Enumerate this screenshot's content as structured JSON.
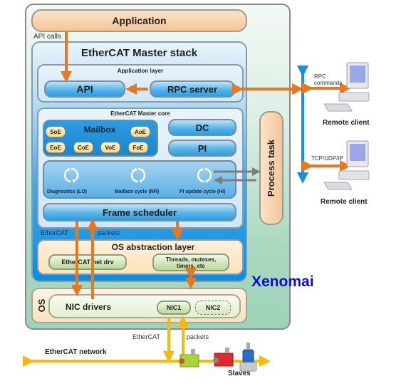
{
  "application": "Application",
  "api_calls": "API calls",
  "master_stack": {
    "title": "EtherCAT Master stack",
    "application_layer": {
      "title": "Application layer",
      "api": "API",
      "rpc_server": "RPC server"
    },
    "core": {
      "title": "EtherCAT Master core",
      "mailbox": {
        "title": "Mailbox",
        "protocols": [
          "SoE",
          "AoE",
          "EoE",
          "CoE",
          "VoE",
          "FoE"
        ]
      },
      "dc": "DC",
      "pi": "PI",
      "cycles": [
        "Diagnostics (LO)",
        "Mailbox cycle (NR)",
        "PI update cycle (HI)"
      ],
      "frame_scheduler": "Frame scheduler"
    },
    "ethercat_label": "EtherCAT",
    "packets_label": "packets",
    "os_abstraction": {
      "title": "OS abstraction layer",
      "net_drv": "EtherCAT net drv",
      "threads_line1": "Threads, mutexes,",
      "threads_line2": "timers, etc"
    }
  },
  "os": {
    "label": "OS",
    "nic_drivers": "NIC drivers",
    "nic1": "NIC1",
    "nic2": "NIC2"
  },
  "process_task": "Process task",
  "xenomai": "Xenomai",
  "remote": {
    "rpc_commands_line1": "RPC",
    "rpc_commands_line2": "commands",
    "tcp": "TCP/UDP/IP",
    "client1": "Remote client",
    "client2": "Remote client"
  },
  "network": {
    "ethercat": "EtherCAT",
    "packets": "packets",
    "label": "EtherCAT network",
    "slaves": "Slaves"
  },
  "colors": {
    "orange_arrow": "#e87722",
    "yellow_bus": "#f7b90f",
    "blue_bus": "#1a8ee0",
    "gray_arrow": "#7d7d7d",
    "xenomai_text": "#1010d8"
  }
}
